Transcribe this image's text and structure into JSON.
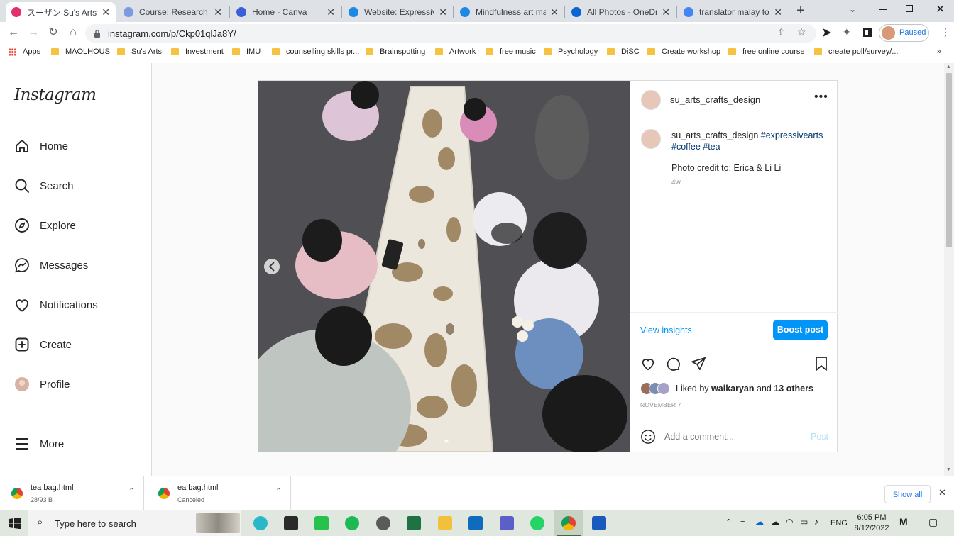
{
  "browser": {
    "tabs": [
      {
        "title": "スーザン Su's Arts, Craft",
        "color": "#e1306c",
        "active": true
      },
      {
        "title": "Course: Research Met",
        "color": "#7b9ae0",
        "active": false
      },
      {
        "title": "Home - Canva",
        "color": "#3a5fd9",
        "active": false
      },
      {
        "title": "Website: Expressive A",
        "color": "#1e88e5",
        "active": false
      },
      {
        "title": "Mindfulness art makin",
        "color": "#1e88e5",
        "active": false
      },
      {
        "title": "All Photos - OneDrive",
        "color": "#0a64d2",
        "active": false
      },
      {
        "title": "translator malay to en",
        "color": "#4285f4",
        "active": false
      }
    ],
    "url": "instagram.com/p/Ckp01qlJa8Y/",
    "profile_status": "Paused",
    "bookmarks": [
      "Apps",
      "MAOLHOUS",
      "Su's Arts",
      "Investment",
      "IMU",
      "counselling skills pr...",
      "Brainspotting",
      "Artwork",
      "free music",
      "Psychology",
      "DiSC",
      "Create workshop",
      "free online course",
      "create poll/survey/..."
    ]
  },
  "instagram": {
    "logo": "Instagram",
    "nav": [
      {
        "label": "Home",
        "icon": "home-icon"
      },
      {
        "label": "Search",
        "icon": "search-icon"
      },
      {
        "label": "Explore",
        "icon": "compass-icon"
      },
      {
        "label": "Messages",
        "icon": "messenger-icon"
      },
      {
        "label": "Notifications",
        "icon": "heart-icon"
      },
      {
        "label": "Create",
        "icon": "plus-square-icon"
      },
      {
        "label": "Profile",
        "icon": "avatar-icon"
      }
    ],
    "more_label": "More",
    "post": {
      "username": "su_arts_crafts_design",
      "caption_tags": "#expressivearts",
      "caption_tags2": "#coffee #tea",
      "credit": "Photo credit to: Erica & Li Li",
      "age": "4w",
      "view_insights": "View insights",
      "boost": "Boost post",
      "liked_prefix": "Liked by",
      "liked_user": "waikaryan",
      "liked_and": "and",
      "liked_others": "13 others",
      "date": "NOVEMBER 7",
      "comment_placeholder": "Add a comment...",
      "post_button": "Post"
    }
  },
  "downloads": [
    {
      "name": "tea bag.html",
      "status": "28/93 B"
    },
    {
      "name": "ea bag.html",
      "status": "Canceled"
    }
  ],
  "downloads_show_all": "Show all",
  "taskbar": {
    "search_placeholder": "Type here to search",
    "lang": "ENG",
    "time": "6:05 PM",
    "date": "8/12/2022"
  }
}
